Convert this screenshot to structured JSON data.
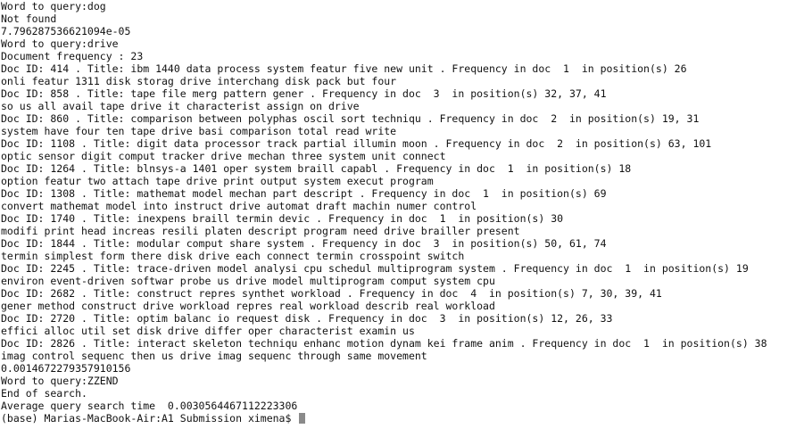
{
  "terminal": {
    "lines": [
      "Word to query:dog",
      "Not found",
      "7.796287536621094e-05",
      "Word to query:drive",
      "Document frequency : 23",
      "Doc ID: 414 . Title: ibm 1440 data process system featur five new unit . Frequency in doc  1  in position(s) 26",
      "onli featur 1311 disk storag drive interchang disk pack but four",
      "Doc ID: 858 . Title: tape file merg pattern gener . Frequency in doc  3  in position(s) 32, 37, 41",
      "so us all avail tape drive it characterist assign on drive",
      "Doc ID: 860 . Title: comparison between polyphas oscil sort techniqu . Frequency in doc  2  in position(s) 19, 31",
      "system have four ten tape drive basi comparison total read write",
      "Doc ID: 1108 . Title: digit data processor track partial illumin moon . Frequency in doc  2  in position(s) 63, 101",
      "optic sensor digit comput tracker drive mechan three system unit connect",
      "Doc ID: 1264 . Title: blnsys-a 1401 oper system braill capabl . Frequency in doc  1  in position(s) 18",
      "option featur two attach tape drive print output system execut program",
      "Doc ID: 1308 . Title: mathemat model mechan part descript . Frequency in doc  1  in position(s) 69",
      "convert mathemat model into instruct drive automat draft machin numer control",
      "Doc ID: 1740 . Title: inexpens braill termin devic . Frequency in doc  1  in position(s) 30",
      "modifi print head increas resili platen descript program need drive brailler present",
      "Doc ID: 1844 . Title: modular comput share system . Frequency in doc  3  in position(s) 50, 61, 74",
      "termin simplest form there disk drive each connect termin crosspoint switch",
      "Doc ID: 2245 . Title: trace-driven model analysi cpu schedul multiprogram system . Frequency in doc  1  in position(s) 19",
      "environ event-driven softwar probe us drive model multiprogram comput system cpu",
      "Doc ID: 2682 . Title: construct repres synthet workload . Frequency in doc  4  in position(s) 7, 30, 39, 41",
      "gener method construct drive workload repres real workload describ real workload",
      "Doc ID: 2720 . Title: optim balanc io request disk . Frequency in doc  3  in position(s) 12, 26, 33",
      "effici alloc util set disk drive differ oper characterist examin us",
      "Doc ID: 2826 . Title: interact skeleton techniqu enhanc motion dynam kei frame anim . Frequency in doc  1  in position(s) 38",
      "imag control sequenc then us drive imag sequenc through same movement",
      "0.0014672279357910156",
      "Word to query:ZZEND",
      "End of search.",
      "Average query search time  0.003056446711222330 6"
    ],
    "prompt": "(base) Marias-MacBook-Air:A1 Submission ximena$ ",
    "cursor_icon": "block-cursor-icon"
  }
}
